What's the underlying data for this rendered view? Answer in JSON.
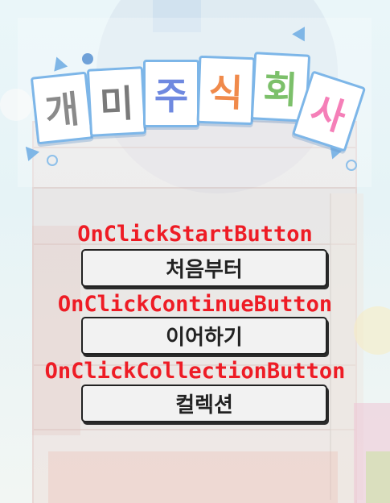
{
  "logo": {
    "tiles": [
      {
        "char": "개",
        "color": "#8a8a8a"
      },
      {
        "char": "미",
        "color": "#7a7a7a"
      },
      {
        "char": "주",
        "color": "#6f89e0"
      },
      {
        "char": "식",
        "color": "#f08a4b"
      },
      {
        "char": "회",
        "color": "#7cc06a"
      },
      {
        "char": "사",
        "color": "#f57fb8"
      }
    ]
  },
  "menu": {
    "start": {
      "handler": "OnClickStartButton",
      "label": "처음부터"
    },
    "continue": {
      "handler": "OnClickContinueButton",
      "label": "이어하기"
    },
    "collection": {
      "handler": "OnClickCollectionButton",
      "label": "컬렉션"
    }
  },
  "colors": {
    "handler_text": "#ee1c25",
    "button_bg": "#f2f2f2",
    "button_border": "#222222",
    "tile_border": "#7db6e8"
  }
}
